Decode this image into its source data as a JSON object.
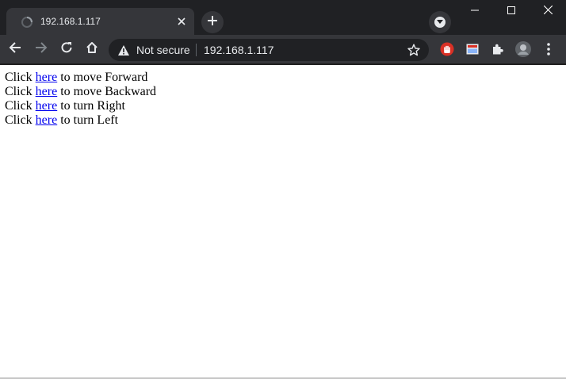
{
  "tab": {
    "title": "192.168.1.117",
    "favicon": "loading-globe-icon",
    "close_icon": "close-icon"
  },
  "window_controls": [
    "minimize-icon",
    "maximize-icon",
    "close-icon"
  ],
  "toolbar": {
    "back_icon": "arrow-left-icon",
    "forward_icon": "arrow-right-icon",
    "reload_icon": "reload-icon",
    "home_icon": "home-icon",
    "security_label": "Not secure",
    "url": "192.168.1.117",
    "bookmark_icon": "star-icon",
    "extensions": [
      "stop-hand-extension-icon",
      "card-extension-icon",
      "puzzle-icon",
      "profile-avatar"
    ],
    "menu_icon": "kebab-menu-icon"
  },
  "page": {
    "lines": [
      {
        "prefix": "Click ",
        "link": "here",
        "suffix": " to move Forward"
      },
      {
        "prefix": "Click ",
        "link": "here",
        "suffix": " to move Backward"
      },
      {
        "prefix": "Click ",
        "link": "here",
        "suffix": " to turn Right"
      },
      {
        "prefix": "Click ",
        "link": "here",
        "suffix": " to turn Left"
      }
    ]
  },
  "colors": {
    "frame": "#202124",
    "toolbar": "#35363a",
    "link": "#0000ee",
    "extension_red": "#d93025"
  }
}
